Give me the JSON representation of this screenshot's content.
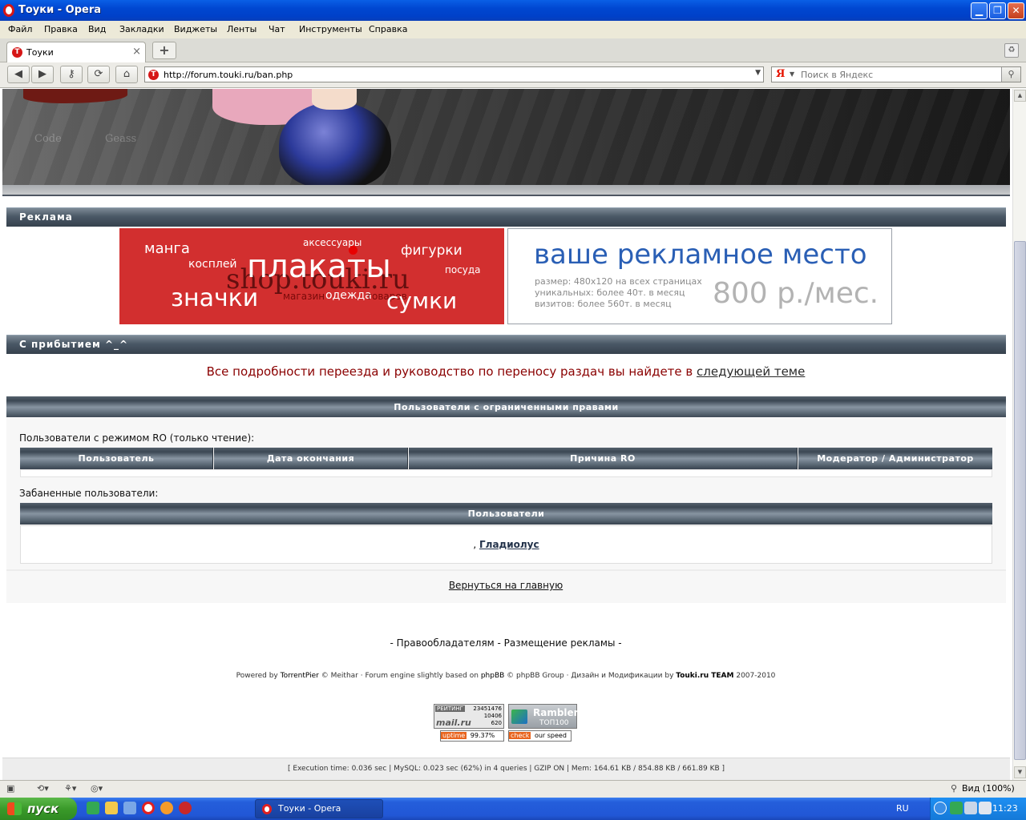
{
  "window": {
    "title": "Тоуки - Opera"
  },
  "menu": [
    "Файл",
    "Правка",
    "Вид",
    "Закладки",
    "Виджеты",
    "Ленты",
    "Чат",
    "Инструменты",
    "Справка"
  ],
  "tab": {
    "label": "Тоуки",
    "close": "×"
  },
  "address": {
    "url": "http://forum.touki.ru/ban.php"
  },
  "search": {
    "engine": "Я",
    "placeholder": "Поиск в Яндекс"
  },
  "banner": {
    "text_left": "Code",
    "text_right": "Geass"
  },
  "ads": {
    "section_title": "Реклама",
    "shop": {
      "big": "плакаты",
      "manga": "манга",
      "cosplay": "косплей",
      "accessories": "аксессуары",
      "figures": "фигурки",
      "dishes": "посуда",
      "badges": "значки",
      "bags": "сумки",
      "clothes": "одежда",
      "store": "магазин",
      "goods": "товаров",
      "site": "shop.touki.ru"
    },
    "place": {
      "title": "ваше рекламное место",
      "line1": "размер: 480x120 на всех страницах",
      "line2": "уникальных: более 40т. в месяц",
      "line3": "визитов: более 560т. в месяц",
      "price": "800 р./мес."
    }
  },
  "welcome": {
    "section_title": "С прибытием ^_^",
    "notice_text": "Все подробности переезда и руководство по переносу раздач вы найдете в ",
    "notice_link": "следующей теме"
  },
  "restricted": {
    "header": "Пользователи с ограниченными правами",
    "ro_label": "Пользователи с режимом RO (только чтение):",
    "columns": [
      "Пользователь",
      "Дата окончания",
      "Причина RO",
      "Модератор / Администратор"
    ],
    "banned_label": "Забаненные пользователи:",
    "banned_header": "Пользователи",
    "banned_prefix": ",",
    "banned_user": "Гладиолус"
  },
  "back_link": "Вернуться на главную",
  "footer": {
    "links_text": "- Правообладателям - Размещение рекламы -",
    "powered_1": "Powered by ",
    "powered_2": "TorrentPier",
    "powered_3": " © Meithar · Forum engine slightly based on ",
    "powered_4": "phpBB",
    "powered_5": " © phpBB Group · Дизайн и Модификации by ",
    "powered_6": "Touki.ru TEAM",
    "powered_7": " 2007-2010",
    "mail_rating": "РЕЙТИНГ",
    "mail_num1": "23451476",
    "mail_num2": "10406",
    "mail_num3": "620",
    "mail_brand": "mail.ru",
    "rambler": "Rambler",
    "rambler_top": "ТОП100",
    "uptime_label": "uptime",
    "uptime_value": "99.37%",
    "check_label": "check",
    "check_value": "our speed",
    "exec_stats": "[  Execution time: 0.036 sec  |  MySQL: 0.023 sec (62%) in 4 queries  |  GZIP ON  |  Mem: 164.61 KB / 854.88 KB / 661.89 KB  ]"
  },
  "statusbar": {
    "zoom": "Вид (100%)"
  },
  "taskbar": {
    "start": "пуск",
    "item": "Тоуки - Opera",
    "lang": "RU",
    "clock": "11:23"
  }
}
